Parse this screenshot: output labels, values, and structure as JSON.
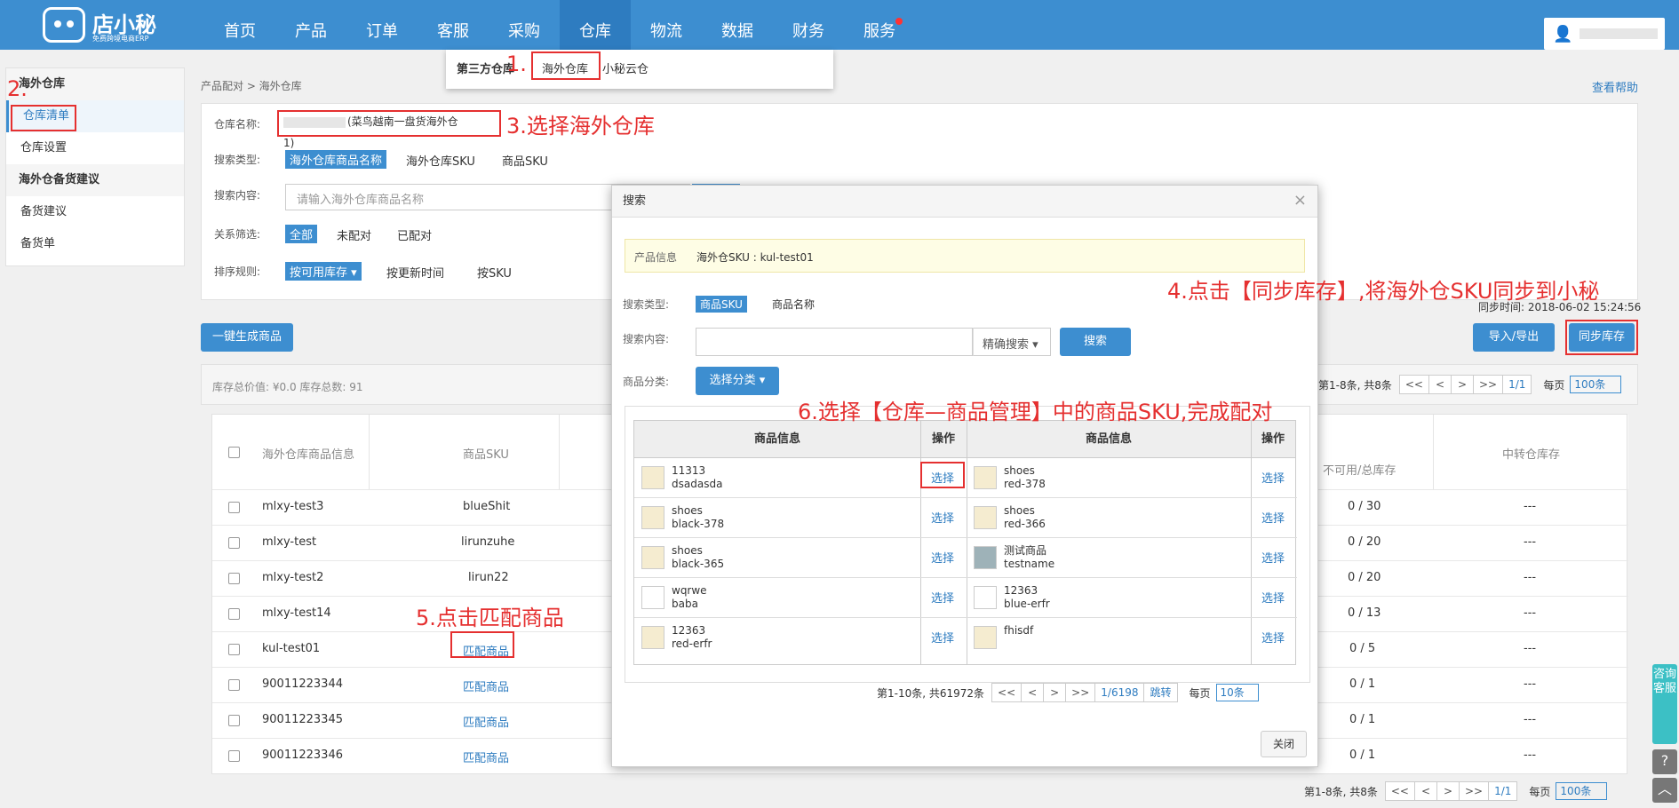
{
  "app": {
    "name": "店小秘",
    "subtitle": "免费跨境电商ERP"
  },
  "nav": [
    "首页",
    "产品",
    "订单",
    "客服",
    "采购",
    "仓库",
    "物流",
    "数据",
    "财务",
    "服务"
  ],
  "dropdown": {
    "title": "第三方仓库",
    "items": [
      "海外仓库",
      "小秘云仓"
    ]
  },
  "sidebar": {
    "group1": "海外仓库",
    "items1": [
      "仓库清单",
      "仓库设置"
    ],
    "group2": "海外仓备货建议",
    "items2": [
      "备货建议",
      "备货单"
    ]
  },
  "breadcrumb": "产品配对 > 海外仓库",
  "help": "查看帮助",
  "filter": {
    "warehouse_label": "仓库名称:",
    "warehouse_value": "(菜鸟越南一盘货海外仓1)",
    "search_type_label": "搜索类型:",
    "search_types": [
      "海外仓库商品名称",
      "海外仓库SKU",
      "商品SKU"
    ],
    "search_content_label": "搜索内容:",
    "search_placeholder": "请输入海外仓库商品名称",
    "relation_label": "关系筛选:",
    "relations": [
      "全部",
      "未配对",
      "已配对"
    ],
    "sort_label": "排序规则:",
    "sorts": [
      "按可用库存 ▾",
      "按更新时间",
      "按SKU"
    ]
  },
  "actions": {
    "generate": "一键生成商品",
    "import_export": "导入/导出",
    "sync": "同步库存",
    "sync_time": "同步时间: 2018-06-02 15:24:56"
  },
  "stats": "库存总价值: ¥0.0 库存总数: 91",
  "pager_main": {
    "info": "第1-8条, 共8条",
    "buttons": [
      "<<",
      "<",
      ">",
      ">>"
    ],
    "page": "1/1",
    "per_label": "每页",
    "per": "100条"
  },
  "table": {
    "headers": [
      "海外仓库商品信息",
      "商品SKU",
      "不可用/总库存",
      "中转仓库存"
    ],
    "rows": [
      {
        "name": "mlxy-test3",
        "sku": "blueShit",
        "stock": "0 / 30",
        "transit": "---"
      },
      {
        "name": "mlxy-test",
        "sku": "lirunzuhe",
        "stock": "0 / 20",
        "transit": "---"
      },
      {
        "name": "mlxy-test2",
        "sku": "lirun22",
        "stock": "0 / 20",
        "transit": "---"
      },
      {
        "name": "mlxy-test14",
        "sku": "",
        "stock": "0 / 13",
        "transit": "---"
      },
      {
        "name": "kul-test01",
        "sku": "匹配商品",
        "stock": "0 / 5",
        "transit": "---"
      },
      {
        "name": "90011223344",
        "sku": "匹配商品",
        "stock": "0 / 1",
        "transit": "---"
      },
      {
        "name": "90011223345",
        "sku": "匹配商品",
        "stock": "0 / 1",
        "transit": "---"
      },
      {
        "name": "90011223346",
        "sku": "匹配商品",
        "stock": "0 / 1",
        "transit": "---"
      }
    ]
  },
  "modal": {
    "title": "搜索",
    "close": "×",
    "info_label": "产品信息",
    "info_value": "海外仓SKU : kul-test01",
    "search_type_label": "搜索类型:",
    "search_types": [
      "商品SKU",
      "商品名称"
    ],
    "search_content_label": "搜索内容:",
    "search_mode": "精确搜索 ▾",
    "search_btn": "搜索",
    "category_label": "商品分类:",
    "category_btn": "选择分类 ▾",
    "headers": [
      "商品信息",
      "操作",
      "商品信息",
      "操作"
    ],
    "rows": [
      {
        "l1": "11313",
        "l2": "dsadasda",
        "r1": "shoes",
        "r2": "red-378"
      },
      {
        "l1": "shoes",
        "l2": "black-378",
        "r1": "shoes",
        "r2": "red-366"
      },
      {
        "l1": "shoes",
        "l2": "black-365",
        "r1": "测试商品",
        "r2": "testname"
      },
      {
        "l1": "wqrwe",
        "l2": "baba",
        "r1": "12363",
        "r2": "blue-erfr"
      },
      {
        "l1": "12363",
        "l2": "red-erfr",
        "r1": "fhisdf",
        "r2": ""
      }
    ],
    "select_label": "选择",
    "pager": {
      "info": "第1-10条, 共61972条",
      "buttons": [
        "<<",
        "<",
        ">",
        ">>"
      ],
      "page": "1/6198",
      "jump": "跳转",
      "per_label": "每页",
      "per": "10条"
    },
    "close_btn": "关闭"
  },
  "annotations": {
    "a1": "1.",
    "a2": "2.",
    "a3": "3.选择海外仓库",
    "a4": "4.点击【同步库存】,将海外仓SKU同步到小秘",
    "a5": "5.点击匹配商品",
    "a6": "6.选择【仓库—商品管理】中的商品SKU,完成配对"
  },
  "float": {
    "service": "咨询客服",
    "help": "?",
    "top": "︿"
  }
}
